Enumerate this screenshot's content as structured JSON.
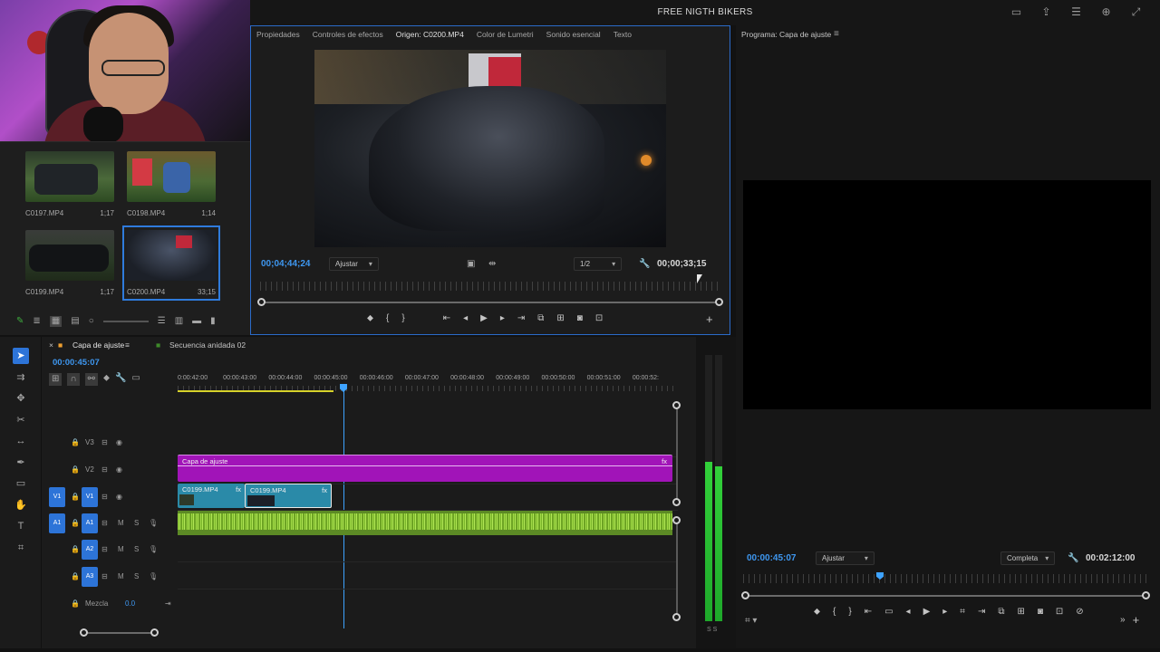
{
  "app_title": "FREE NIGTH BIKERS",
  "bin": {
    "clips": [
      {
        "name": "C0197.MP4",
        "duration": "1;17"
      },
      {
        "name": "C0198.MP4",
        "duration": "1;14"
      },
      {
        "name": "C0199.MP4",
        "duration": "1;17"
      },
      {
        "name": "C0200.MP4",
        "duration": "33;15"
      }
    ]
  },
  "source": {
    "tabs": [
      "Propiedades",
      "Controles de efectos",
      "Origen: C0200.MP4",
      "Color de Lumetri",
      "Sonido esencial",
      "Texto"
    ],
    "timecode_left": "00;04;44;24",
    "fit": "Ajustar",
    "resolution": "1/2",
    "timecode_right": "00;00;33;15"
  },
  "program": {
    "title": "Programa: Capa de ajuste",
    "timecode_left": "00:00:45:07",
    "fit": "Ajustar",
    "resolution": "Completa",
    "timecode_right": "00:02:12:00"
  },
  "timeline": {
    "tabs": [
      "Capa de ajuste",
      "Secuencia anidada 02"
    ],
    "timecode": "00:00:45:07",
    "ruler_labels": [
      "0:00:42:00",
      "00:00:43:00",
      "00:00:44:00",
      "00:00:45:00",
      "00:00:46:00",
      "00:00:47:00",
      "00:00:48:00",
      "00:00:49:00",
      "00:00:50:00",
      "00:00:51:00",
      "00:00:52:"
    ],
    "tracks": {
      "v3": "V3",
      "v2": "V2",
      "v1_src": "V1",
      "v1": "V1",
      "a1_src": "A1",
      "a1": "A1",
      "a2": "A2",
      "a3": "A3",
      "mix_label": "Mezcla",
      "mix_value": "0.0",
      "mute": "M",
      "solo": "S"
    },
    "clips": {
      "adjustment": "Capa de ajuste",
      "v1_a": "C0199.MP4",
      "v1_b": "C0199.MP4",
      "fx": "fx"
    }
  },
  "meters": {
    "scale": "S  S",
    "left_level": 0.6,
    "right_level": 0.58
  },
  "colors": {
    "accent": "#2d74d8",
    "adjustment_clip": "#a114b8",
    "video_clip": "#2a8aa8",
    "audio_clip": "#6ca52a",
    "timecode": "#3e97f0"
  }
}
